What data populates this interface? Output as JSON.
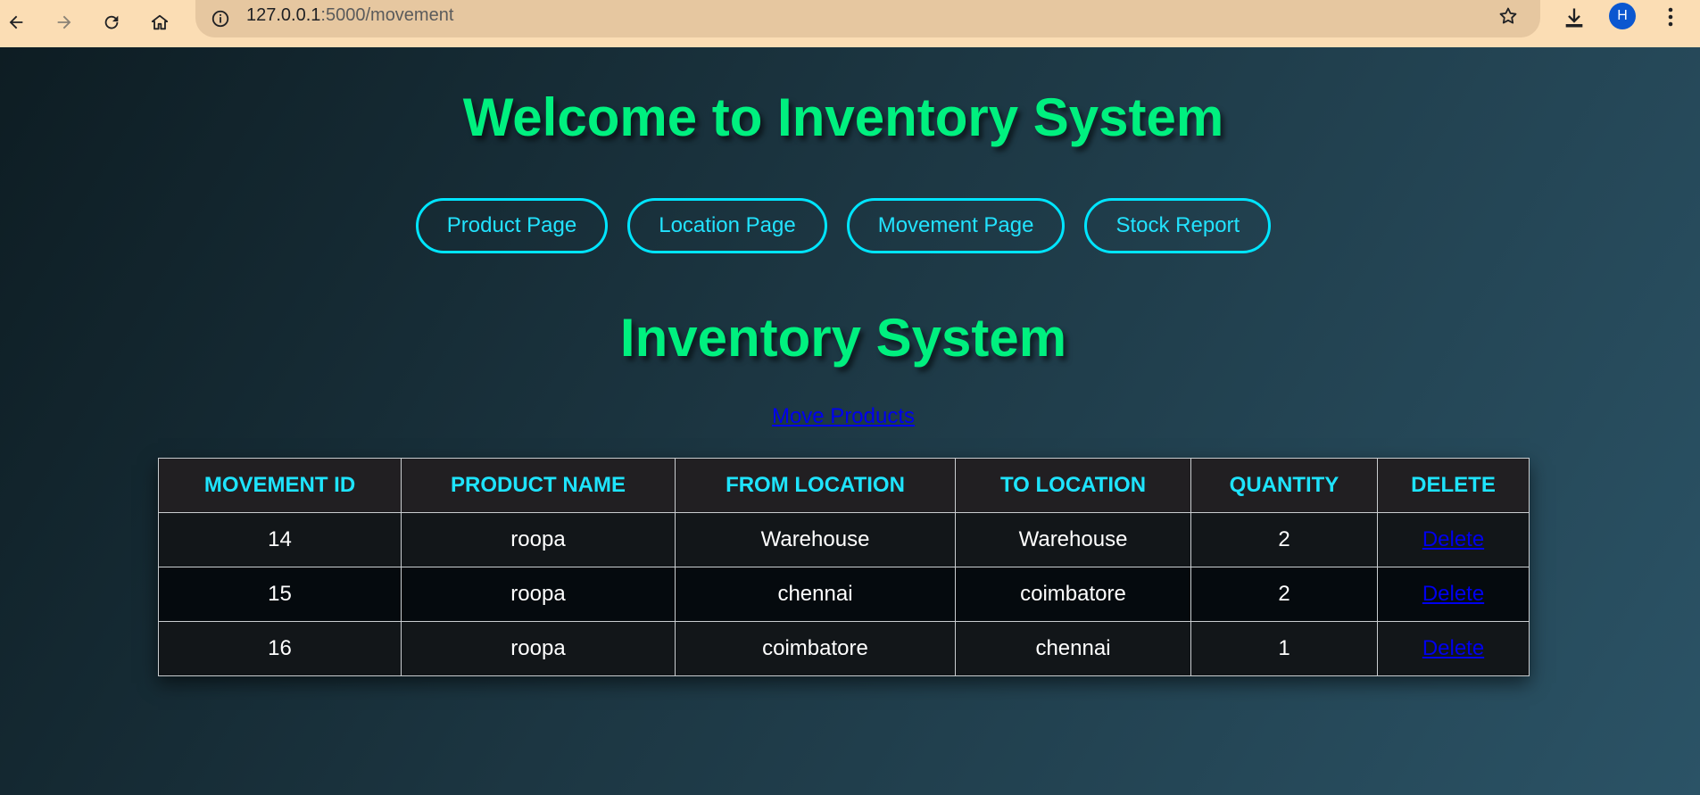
{
  "browser": {
    "url_host": "127.0.0.1",
    "url_path": ":5000/movement",
    "avatar_letter": "H"
  },
  "page": {
    "title": "Welcome to Inventory System",
    "section_title": "Inventory System",
    "nav": [
      "Product Page",
      "Location Page",
      "Movement Page",
      "Stock Report"
    ],
    "move_link": "Move Products"
  },
  "table": {
    "headers": [
      "MOVEMENT ID",
      "PRODUCT NAME",
      "FROM LOCATION",
      "TO LOCATION",
      "QUANTITY",
      "DELETE"
    ],
    "rows": [
      {
        "id": "14",
        "product": "roopa",
        "from": "Warehouse",
        "to": "Warehouse",
        "qty": "2",
        "action": "Delete"
      },
      {
        "id": "15",
        "product": "roopa",
        "from": "chennai",
        "to": "coimbatore",
        "qty": "2",
        "action": "Delete"
      },
      {
        "id": "16",
        "product": "roopa",
        "from": "coimbatore",
        "to": "chennai",
        "qty": "1",
        "action": "Delete"
      }
    ]
  },
  "colors": {
    "heading": "#00f07f",
    "button_border": "#00e5ff",
    "link": "#0000ee"
  }
}
